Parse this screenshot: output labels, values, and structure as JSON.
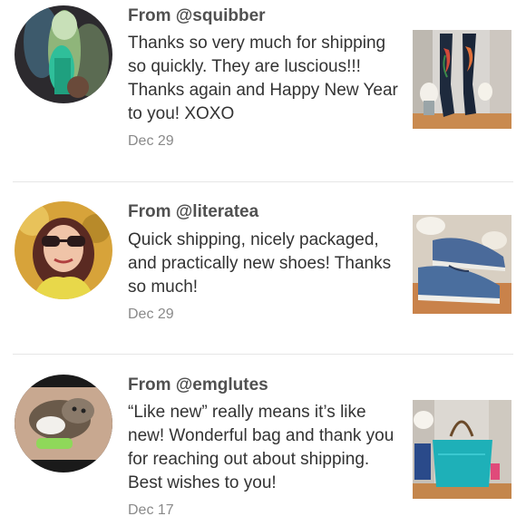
{
  "reviews": [
    {
      "author": "From @squibber",
      "text": "Thanks so very much for shipping so quickly. They are luscious!!! Thanks again and Happy New Year to you! XOXO",
      "date": "Dec 29"
    },
    {
      "author": "From @literatea",
      "text": "Quick shipping, nicely packaged, and practically new shoes! Thanks so much!",
      "date": "Dec 29"
    },
    {
      "author": "From @emglutes",
      "text": "“Like new” really means it’s like new! Wonderful bag and thank you for reaching out about shipping. Best wishes to you!",
      "date": "Dec 17"
    }
  ]
}
